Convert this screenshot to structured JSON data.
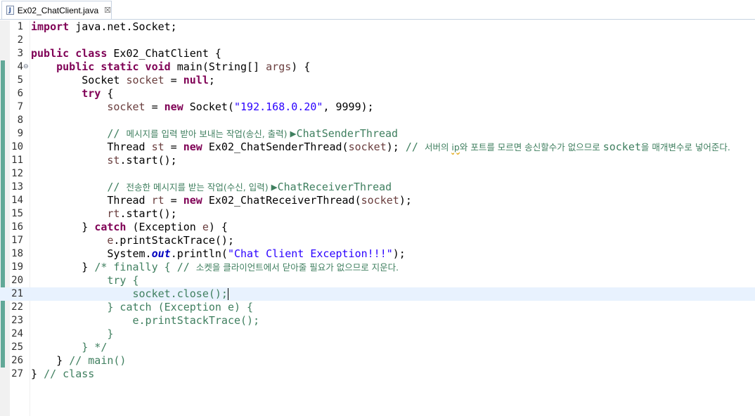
{
  "tab": {
    "filename": "Ex02_ChatClient.java",
    "icon": "java-file-icon",
    "close_glyph": "☒"
  },
  "colors": {
    "keyword": "#7f0055",
    "string": "#2a00ff",
    "comment": "#3f7f5f",
    "field": "#0000c0",
    "variable": "#6a3e3e",
    "current_line": "#e8f2fe",
    "change_bar": "#61a897"
  },
  "editor": {
    "current_line": 21,
    "lines": [
      [
        [
          "k",
          "import"
        ],
        [
          "t",
          " java.net.Socket;"
        ]
      ],
      [],
      [
        [
          "k",
          "public class"
        ],
        [
          "t",
          " Ex02_ChatClient {"
        ]
      ],
      [
        [
          "t",
          "    "
        ],
        [
          "k",
          "public static void"
        ],
        [
          "t",
          " main(String[] "
        ],
        [
          "v",
          "args"
        ],
        [
          "t",
          ") {"
        ]
      ],
      [
        [
          "t",
          "        Socket "
        ],
        [
          "v",
          "socket"
        ],
        [
          "t",
          " = "
        ],
        [
          "k",
          "null"
        ],
        [
          "t",
          ";"
        ]
      ],
      [
        [
          "t",
          "        "
        ],
        [
          "k",
          "try"
        ],
        [
          "t",
          " {"
        ]
      ],
      [
        [
          "t",
          "            "
        ],
        [
          "v",
          "socket"
        ],
        [
          "t",
          " = "
        ],
        [
          "k",
          "new"
        ],
        [
          "t",
          " Socket("
        ],
        [
          "s",
          "\"192.168.0.20\""
        ],
        [
          "t",
          ", 9999);"
        ]
      ],
      [],
      [
        [
          "t",
          "            "
        ],
        [
          "c",
          "// "
        ],
        [
          "ck",
          "메시지를 입력 받아 보내는 작업(송신, 출력) "
        ],
        [
          "c",
          "▶ChatSenderThread"
        ]
      ],
      [
        [
          "t",
          "            Thread "
        ],
        [
          "v",
          "st"
        ],
        [
          "t",
          " = "
        ],
        [
          "k",
          "new"
        ],
        [
          "t",
          " Ex02_ChatSenderThread("
        ],
        [
          "v",
          "socket"
        ],
        [
          "t",
          "); "
        ],
        [
          "c",
          "// "
        ],
        [
          "ck",
          "서버의 "
        ],
        [
          "cs",
          "ip"
        ],
        [
          "ck",
          "와 포트를 모르면 송신할수가 없으므로 "
        ],
        [
          "c",
          "socket"
        ],
        [
          "ck",
          "을 매개변수로 넣어준다."
        ]
      ],
      [
        [
          "t",
          "            "
        ],
        [
          "v",
          "st"
        ],
        [
          "t",
          ".start();"
        ]
      ],
      [],
      [
        [
          "t",
          "            "
        ],
        [
          "c",
          "// "
        ],
        [
          "ck",
          "전송한 메시지를 받는 작업(수신, 입력) "
        ],
        [
          "c",
          "▶ChatReceiverThread"
        ]
      ],
      [
        [
          "t",
          "            Thread "
        ],
        [
          "v",
          "rt"
        ],
        [
          "t",
          " = "
        ],
        [
          "k",
          "new"
        ],
        [
          "t",
          " Ex02_ChatReceiverThread("
        ],
        [
          "v",
          "socket"
        ],
        [
          "t",
          ");"
        ]
      ],
      [
        [
          "t",
          "            "
        ],
        [
          "v",
          "rt"
        ],
        [
          "t",
          ".start();"
        ]
      ],
      [
        [
          "t",
          "        } "
        ],
        [
          "k",
          "catch"
        ],
        [
          "t",
          " (Exception "
        ],
        [
          "v",
          "e"
        ],
        [
          "t",
          ") {"
        ]
      ],
      [
        [
          "t",
          "            "
        ],
        [
          "v",
          "e"
        ],
        [
          "t",
          ".printStackTrace();"
        ]
      ],
      [
        [
          "t",
          "            System."
        ],
        [
          "f",
          "out"
        ],
        [
          "t",
          ".println("
        ],
        [
          "s",
          "\"Chat Client Exception!!!\""
        ],
        [
          "t",
          ");"
        ]
      ],
      [
        [
          "t",
          "        } "
        ],
        [
          "c",
          "/* finally { // "
        ],
        [
          "ck",
          "소켓을 클라이언트에서 닫아줄 필요가 없으므로 지운다."
        ]
      ],
      [
        [
          "c",
          "            try {"
        ]
      ],
      [
        [
          "c",
          "                socket.close();"
        ],
        [
          "caret",
          ""
        ]
      ],
      [
        [
          "c",
          "            } catch (Exception e) {"
        ]
      ],
      [
        [
          "c",
          "                e.printStackTrace();"
        ]
      ],
      [
        [
          "c",
          "            }"
        ]
      ],
      [
        [
          "c",
          "        } */"
        ]
      ],
      [
        [
          "t",
          "    } "
        ],
        [
          "c",
          "// main()"
        ]
      ],
      [
        [
          "t",
          "} "
        ],
        [
          "c",
          "// class"
        ]
      ]
    ]
  }
}
